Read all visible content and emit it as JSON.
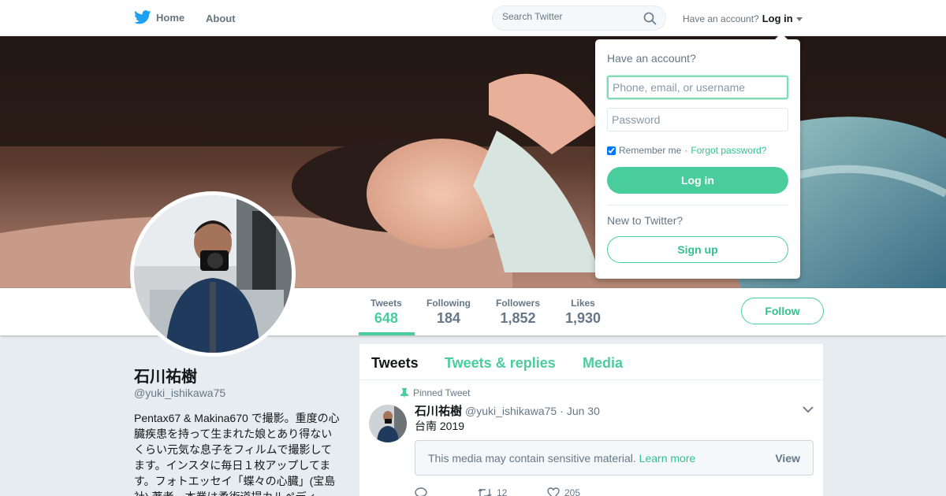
{
  "nav": {
    "home_label": "Home",
    "about_label": "About",
    "search_placeholder": "Search Twitter",
    "have_account": "Have an account?",
    "login_label": "Log in"
  },
  "profile_nav": {
    "stats": [
      {
        "label": "Tweets",
        "value": "648",
        "active": true
      },
      {
        "label": "Following",
        "value": "184"
      },
      {
        "label": "Followers",
        "value": "1,852"
      },
      {
        "label": "Likes",
        "value": "1,930"
      }
    ],
    "follow_label": "Follow"
  },
  "profile": {
    "name": "石川祐樹",
    "handle": "@yuki_ishikawa75",
    "bio": "Pentax67 & Makina670 で撮影。重度の心臓疾患を持って生まれた娘とあり得ないくらい元気な息子をフィルムで撮影してます。インスタに毎日１枚アップしてます。フォトエッセイ「蝶々の心臓」(宝島社) 著者。本業は柔術道場カルペディ"
  },
  "timeline": {
    "tabs": [
      "Tweets",
      "Tweets & replies",
      "Media"
    ],
    "pinned_label": "Pinned Tweet",
    "tweet": {
      "author": "石川祐樹",
      "handle": "@yuki_ishikawa75",
      "dot": "·",
      "date": "Jun 30",
      "text": "台南 2019",
      "sensitive_msg": "This media may contain sensitive material.",
      "learn_more": "Learn more",
      "view_label": "View",
      "retweets": "12",
      "likes": "205"
    }
  },
  "login_dropdown": {
    "title": "Have an account?",
    "username_placeholder": "Phone, email, or username",
    "password_placeholder": "Password",
    "remember_label": "Remember me",
    "separator": "·",
    "forgot_label": "Forgot password?",
    "login_button": "Log in",
    "new_to": "New to Twitter?",
    "signup_button": "Sign up"
  },
  "colors": {
    "accent": "#4acd9c",
    "twitter_blue": "#1da1f2",
    "text_secondary": "#657786"
  }
}
